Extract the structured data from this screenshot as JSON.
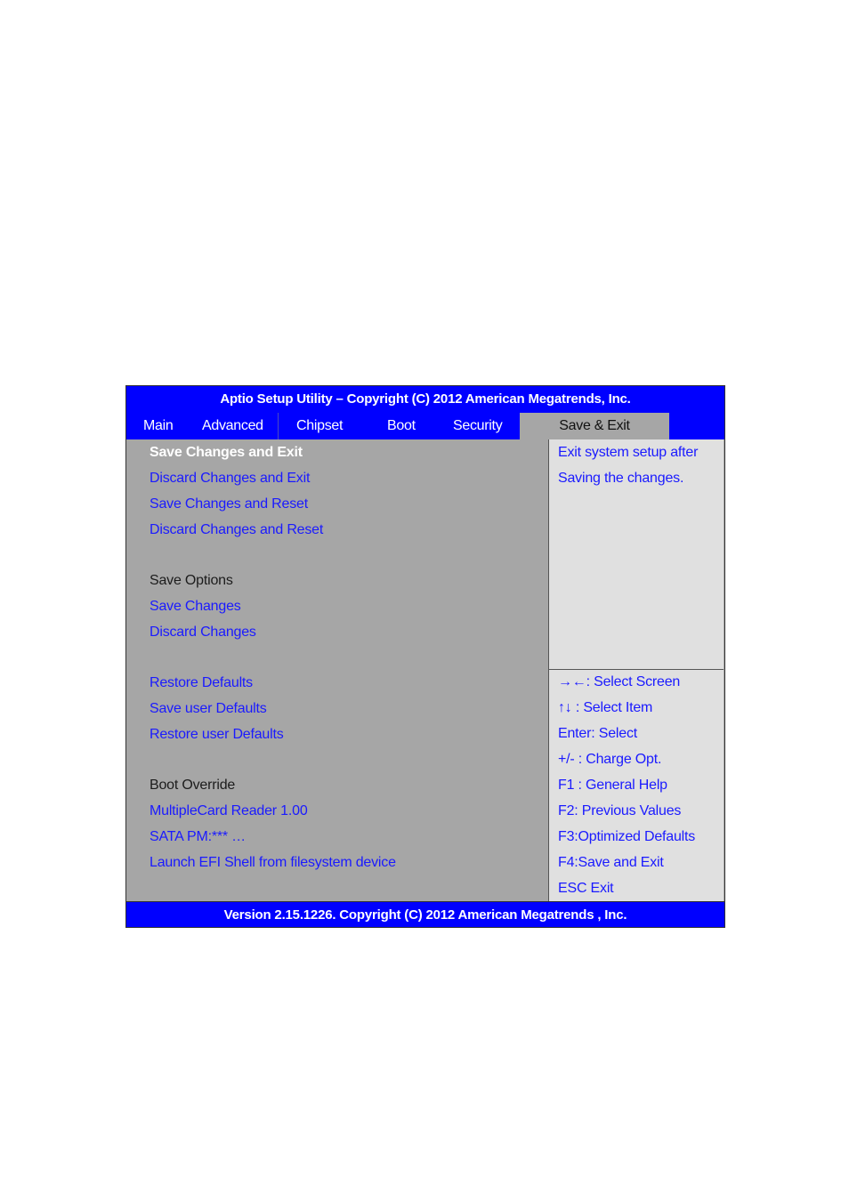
{
  "header": {
    "title": "Aptio Setup Utility – Copyright (C) 2012 American Megatrends, Inc."
  },
  "tabs": [
    {
      "label": "Main",
      "active": false
    },
    {
      "label": "Advanced",
      "active": false
    },
    {
      "label": "Chipset",
      "active": false
    },
    {
      "label": "Boot",
      "active": false
    },
    {
      "label": "Security",
      "active": false
    },
    {
      "label": "Save & Exit",
      "active": true
    }
  ],
  "menu": {
    "items": [
      {
        "label": "Save Changes and Exit",
        "type": "action",
        "selected": true
      },
      {
        "label": "Discard Changes and Exit",
        "type": "action"
      },
      {
        "label": "Save Changes and Reset",
        "type": "action"
      },
      {
        "label": "Discard Changes and Reset",
        "type": "action"
      },
      {
        "label": "Save Options",
        "type": "heading"
      },
      {
        "label": "Save Changes",
        "type": "action"
      },
      {
        "label": "Discard Changes",
        "type": "action"
      },
      {
        "label": "Restore Defaults",
        "type": "action"
      },
      {
        "label": "Save user Defaults",
        "type": "action"
      },
      {
        "label": "Restore user Defaults",
        "type": "action"
      },
      {
        "label": "Boot Override",
        "type": "heading"
      },
      {
        "label": "MultipleCard Reader 1.00",
        "type": "action"
      },
      {
        "label": "SATA PM:*** …",
        "type": "action"
      },
      {
        "label": "Launch EFI Shell from filesystem device",
        "type": "action"
      }
    ]
  },
  "help": {
    "lines": [
      "Exit system setup after",
      "Saving the changes."
    ]
  },
  "keys": {
    "lines": [
      "→←: Select Screen",
      "↑↓   : Select Item",
      "Enter:   Select",
      "+/- : Charge Opt.",
      "F1 : General Help",
      "F2: Previous Values",
      "F3:Optimized Defaults",
      "F4:Save and Exit",
      "ESC   Exit"
    ]
  },
  "footer": {
    "text": "Version 2.15.1226. Copyright (C) 2012 American Megatrends , Inc."
  },
  "colors": {
    "bar_blue": "#0000ff",
    "item_blue": "#1a1aff",
    "panel_gray": "#a6a6a6",
    "help_bg": "#e0e0e0",
    "selected_text": "#ffffff"
  }
}
